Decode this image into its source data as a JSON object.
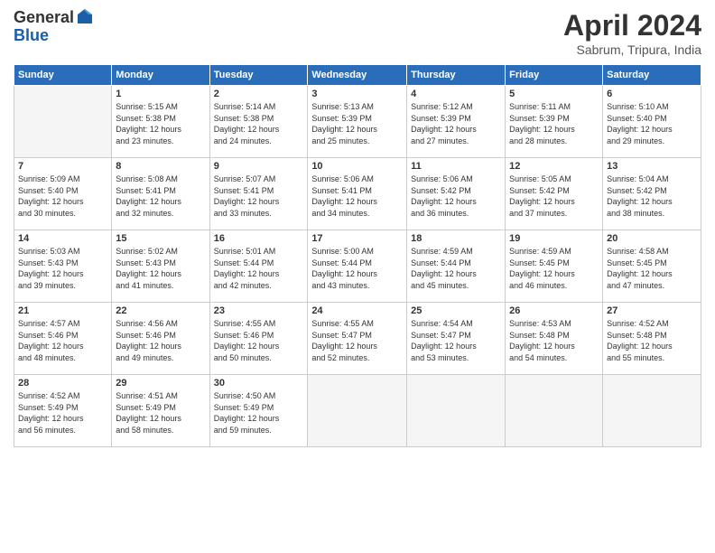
{
  "header": {
    "logo_general": "General",
    "logo_blue": "Blue",
    "month_title": "April 2024",
    "subtitle": "Sabrum, Tripura, India"
  },
  "days_of_week": [
    "Sunday",
    "Monday",
    "Tuesday",
    "Wednesday",
    "Thursday",
    "Friday",
    "Saturday"
  ],
  "weeks": [
    [
      {
        "day": "",
        "info": ""
      },
      {
        "day": "1",
        "info": "Sunrise: 5:15 AM\nSunset: 5:38 PM\nDaylight: 12 hours\nand 23 minutes."
      },
      {
        "day": "2",
        "info": "Sunrise: 5:14 AM\nSunset: 5:38 PM\nDaylight: 12 hours\nand 24 minutes."
      },
      {
        "day": "3",
        "info": "Sunrise: 5:13 AM\nSunset: 5:39 PM\nDaylight: 12 hours\nand 25 minutes."
      },
      {
        "day": "4",
        "info": "Sunrise: 5:12 AM\nSunset: 5:39 PM\nDaylight: 12 hours\nand 27 minutes."
      },
      {
        "day": "5",
        "info": "Sunrise: 5:11 AM\nSunset: 5:39 PM\nDaylight: 12 hours\nand 28 minutes."
      },
      {
        "day": "6",
        "info": "Sunrise: 5:10 AM\nSunset: 5:40 PM\nDaylight: 12 hours\nand 29 minutes."
      }
    ],
    [
      {
        "day": "7",
        "info": "Sunrise: 5:09 AM\nSunset: 5:40 PM\nDaylight: 12 hours\nand 30 minutes."
      },
      {
        "day": "8",
        "info": "Sunrise: 5:08 AM\nSunset: 5:41 PM\nDaylight: 12 hours\nand 32 minutes."
      },
      {
        "day": "9",
        "info": "Sunrise: 5:07 AM\nSunset: 5:41 PM\nDaylight: 12 hours\nand 33 minutes."
      },
      {
        "day": "10",
        "info": "Sunrise: 5:06 AM\nSunset: 5:41 PM\nDaylight: 12 hours\nand 34 minutes."
      },
      {
        "day": "11",
        "info": "Sunrise: 5:06 AM\nSunset: 5:42 PM\nDaylight: 12 hours\nand 36 minutes."
      },
      {
        "day": "12",
        "info": "Sunrise: 5:05 AM\nSunset: 5:42 PM\nDaylight: 12 hours\nand 37 minutes."
      },
      {
        "day": "13",
        "info": "Sunrise: 5:04 AM\nSunset: 5:42 PM\nDaylight: 12 hours\nand 38 minutes."
      }
    ],
    [
      {
        "day": "14",
        "info": "Sunrise: 5:03 AM\nSunset: 5:43 PM\nDaylight: 12 hours\nand 39 minutes."
      },
      {
        "day": "15",
        "info": "Sunrise: 5:02 AM\nSunset: 5:43 PM\nDaylight: 12 hours\nand 41 minutes."
      },
      {
        "day": "16",
        "info": "Sunrise: 5:01 AM\nSunset: 5:44 PM\nDaylight: 12 hours\nand 42 minutes."
      },
      {
        "day": "17",
        "info": "Sunrise: 5:00 AM\nSunset: 5:44 PM\nDaylight: 12 hours\nand 43 minutes."
      },
      {
        "day": "18",
        "info": "Sunrise: 4:59 AM\nSunset: 5:44 PM\nDaylight: 12 hours\nand 45 minutes."
      },
      {
        "day": "19",
        "info": "Sunrise: 4:59 AM\nSunset: 5:45 PM\nDaylight: 12 hours\nand 46 minutes."
      },
      {
        "day": "20",
        "info": "Sunrise: 4:58 AM\nSunset: 5:45 PM\nDaylight: 12 hours\nand 47 minutes."
      }
    ],
    [
      {
        "day": "21",
        "info": "Sunrise: 4:57 AM\nSunset: 5:46 PM\nDaylight: 12 hours\nand 48 minutes."
      },
      {
        "day": "22",
        "info": "Sunrise: 4:56 AM\nSunset: 5:46 PM\nDaylight: 12 hours\nand 49 minutes."
      },
      {
        "day": "23",
        "info": "Sunrise: 4:55 AM\nSunset: 5:46 PM\nDaylight: 12 hours\nand 50 minutes."
      },
      {
        "day": "24",
        "info": "Sunrise: 4:55 AM\nSunset: 5:47 PM\nDaylight: 12 hours\nand 52 minutes."
      },
      {
        "day": "25",
        "info": "Sunrise: 4:54 AM\nSunset: 5:47 PM\nDaylight: 12 hours\nand 53 minutes."
      },
      {
        "day": "26",
        "info": "Sunrise: 4:53 AM\nSunset: 5:48 PM\nDaylight: 12 hours\nand 54 minutes."
      },
      {
        "day": "27",
        "info": "Sunrise: 4:52 AM\nSunset: 5:48 PM\nDaylight: 12 hours\nand 55 minutes."
      }
    ],
    [
      {
        "day": "28",
        "info": "Sunrise: 4:52 AM\nSunset: 5:49 PM\nDaylight: 12 hours\nand 56 minutes."
      },
      {
        "day": "29",
        "info": "Sunrise: 4:51 AM\nSunset: 5:49 PM\nDaylight: 12 hours\nand 58 minutes."
      },
      {
        "day": "30",
        "info": "Sunrise: 4:50 AM\nSunset: 5:49 PM\nDaylight: 12 hours\nand 59 minutes."
      },
      {
        "day": "",
        "info": ""
      },
      {
        "day": "",
        "info": ""
      },
      {
        "day": "",
        "info": ""
      },
      {
        "day": "",
        "info": ""
      }
    ]
  ]
}
